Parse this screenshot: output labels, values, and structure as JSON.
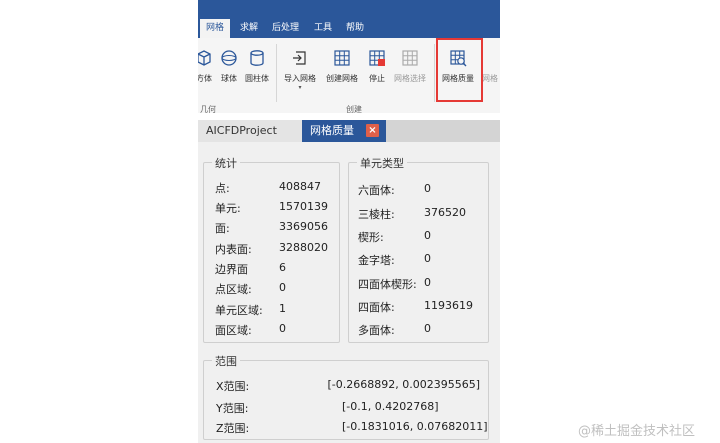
{
  "menu": {
    "tabs": [
      "网格",
      "求解",
      "后处理",
      "工具",
      "帮助"
    ]
  },
  "ribbon": {
    "tools": [
      "方体",
      "球体",
      "圆柱体",
      "导入网格",
      "创建网格",
      "停止",
      "网格选择",
      "网格质量",
      "网格"
    ],
    "groups": [
      "几何",
      "创建"
    ]
  },
  "doc_tabs": {
    "project": "AICFDProject",
    "quality": "网格质量",
    "close": "×"
  },
  "stats": {
    "title": "统计",
    "rows": [
      {
        "label": "点:",
        "value": "408847"
      },
      {
        "label": "单元:",
        "value": "1570139"
      },
      {
        "label": "面:",
        "value": "3369056"
      },
      {
        "label": "内表面:",
        "value": "3288020"
      },
      {
        "label": "边界面",
        "value": "6"
      },
      {
        "label": "点区域:",
        "value": "0"
      },
      {
        "label": "单元区域:",
        "value": "1"
      },
      {
        "label": "面区域:",
        "value": "0"
      }
    ]
  },
  "cell_types": {
    "title": "单元类型",
    "rows": [
      {
        "label": "六面体:",
        "value": "0"
      },
      {
        "label": "三棱柱:",
        "value": "376520"
      },
      {
        "label": "楔形:",
        "value": "0"
      },
      {
        "label": "金字塔:",
        "value": "0"
      },
      {
        "label": "四面体楔形:",
        "value": "0"
      },
      {
        "label": "四面体:",
        "value": "1193619"
      },
      {
        "label": "多面体:",
        "value": "0"
      }
    ]
  },
  "range": {
    "title": "范围",
    "rows": [
      {
        "label": "X范围:",
        "value": "[-0.2668892, 0.002395565]"
      },
      {
        "label": "Y范围:",
        "value": "[-0.1, 0.4202768]"
      },
      {
        "label": "Z范围:",
        "value": "[-0.1831016, 0.07682011]"
      }
    ]
  },
  "watermark": "@稀土掘金技术社区",
  "colors": {
    "ribbon_blue": "#2b579a",
    "highlight_red": "#e53935",
    "close_orange": "#e0604a"
  }
}
